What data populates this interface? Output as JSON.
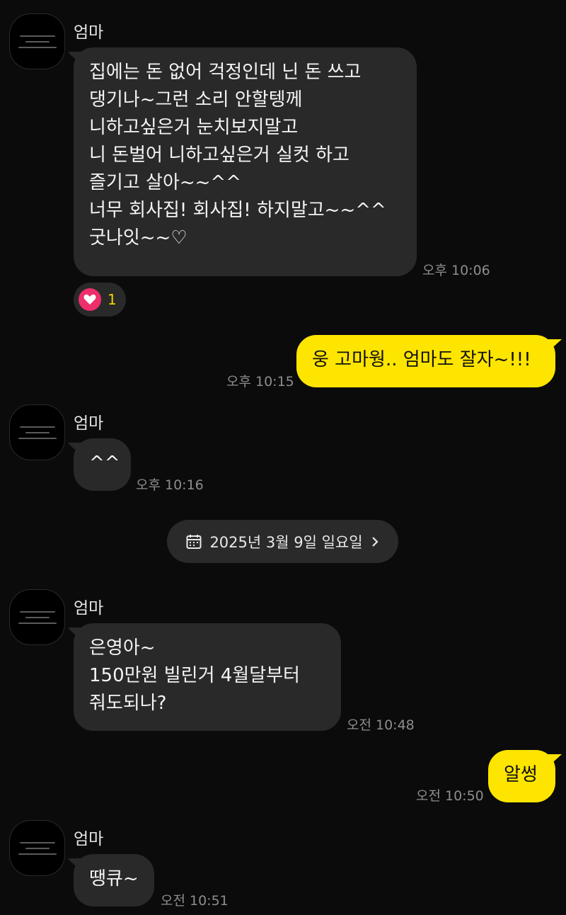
{
  "sender_name": "엄마",
  "messages": [
    {
      "side": "in",
      "text": "집에는 돈 없어 걱정인데 닌 돈 쓰고\n댕기나~그런 소리 안할텡께\n니하고싶은거 눈치보지말고\n니 돈벌어 니하고싶은거 실컷 하고\n즐기고 살아~~^^\n너무 회사집! 회사집! 하지말고~~^^\n굿나잇~~♡",
      "time": "오후 10:06",
      "reaction": {
        "icon": "heart-icon",
        "count": "1"
      }
    },
    {
      "side": "out",
      "text": "웅 고마웡.. 엄마도 잘자~!!!",
      "time": "오후 10:15"
    },
    {
      "side": "in",
      "text": "^^",
      "time": "오후 10:16"
    },
    {
      "side": "in",
      "text": "은영아~\n150만원 빌린거 4월달부터\n줘도되나?",
      "time": "오전 10:48"
    },
    {
      "side": "out",
      "text": "알썽",
      "time": "오전 10:50"
    },
    {
      "side": "in",
      "text": "땡큐~",
      "time": "오전 10:51"
    }
  ],
  "date_divider": {
    "icon": "calendar-icon",
    "label": "2025년 3월 9일 일요일",
    "chevron": "chevron-right-icon"
  },
  "colors": {
    "background": "#0b0b0b",
    "incoming_bubble": "#292929",
    "outgoing_bubble": "#fee500",
    "reaction_heart": "#ee2f6b",
    "reaction_count": "#f0d400"
  }
}
